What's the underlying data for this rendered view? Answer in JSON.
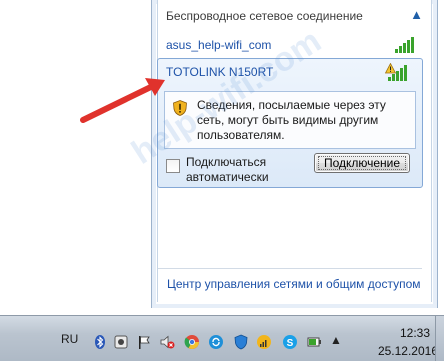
{
  "popup": {
    "section_title": "Беспроводное сетевое соединение",
    "networks": [
      {
        "name": "asus_help-wifi_com",
        "signal_bars": 5
      },
      {
        "name": "TOTOLINK N150RT",
        "signal_bars": 5,
        "secured": false,
        "selected": true
      }
    ],
    "selected": {
      "warning": "Сведения, посылаемые через эту сеть, могут быть видимы другим пользователям.",
      "auto_connect_label": "Подключаться автоматически",
      "auto_connect_checked": false,
      "connect_button": "Подключение"
    },
    "footer_link": "Центр управления сетями и общим доступом"
  },
  "watermark": "help-wifi.com",
  "taskbar": {
    "language": "RU",
    "tray_icons": [
      "bluetooth-icon",
      "network-icon",
      "flag-icon",
      "volume-muted-icon",
      "chrome-icon",
      "sync-icon",
      "shield-icon",
      "wifi-icon",
      "skype-icon",
      "battery-icon"
    ],
    "time": "12:33",
    "date": "25.12.2016"
  },
  "colors": {
    "link": "#1e52a8",
    "signal": "#3aa32c",
    "arrow": "#e0322c",
    "taskbar": "#bac4cf"
  }
}
